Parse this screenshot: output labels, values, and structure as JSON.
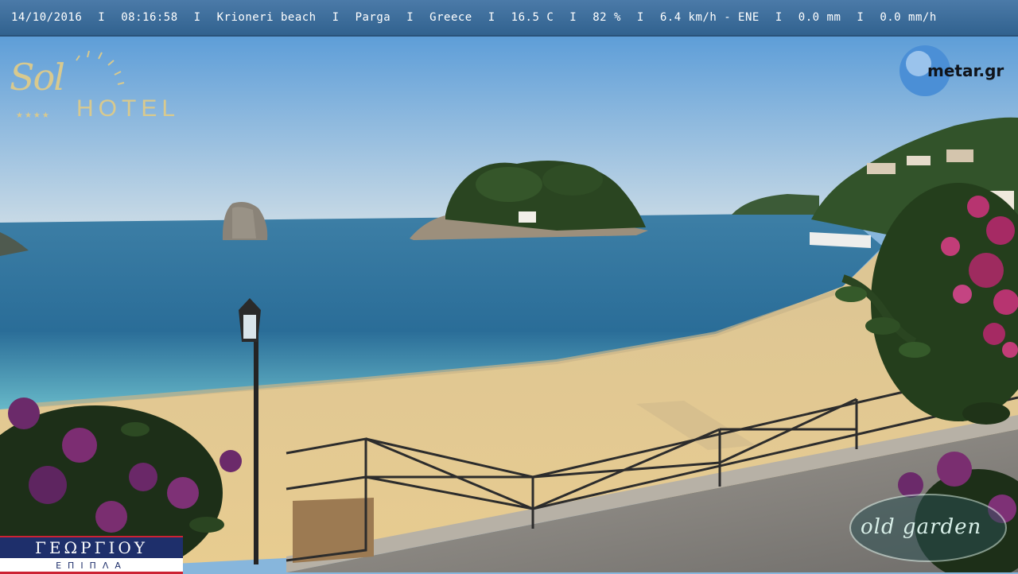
{
  "info_bar": {
    "date": "14/10/2016",
    "time": "08:16:58",
    "location": "Krioneri beach",
    "town": "Parga",
    "country": "Greece",
    "temperature": "16.5 C",
    "humidity": "82 %",
    "wind": "6.4 km/h - ENE",
    "rain": "0.0 mm",
    "rain_rate": "0.0 mm/h",
    "separator": "I"
  },
  "logos": {
    "sol_hotel": {
      "word1": "Sol",
      "word2": "HOTEL",
      "stars": "★★★★"
    },
    "metar": {
      "text": "metar.gr"
    },
    "georgiou": {
      "top": "ΓΕΩΡΓΙΟΥ",
      "bottom": "ΕΠΙΠΛΑ"
    },
    "old_garden": {
      "text": "old garden"
    }
  },
  "colors": {
    "sky_top": "#5f9fd9",
    "sky_bottom": "#c9dbe8",
    "sea_deep": "#2a6a93",
    "sea_shallow": "#5fb3c6",
    "sand": "#e3c78e",
    "foliage": "#2b4a22",
    "bougainvillea": "#b0306e",
    "info_bar_bg": "#3a6c9a"
  }
}
